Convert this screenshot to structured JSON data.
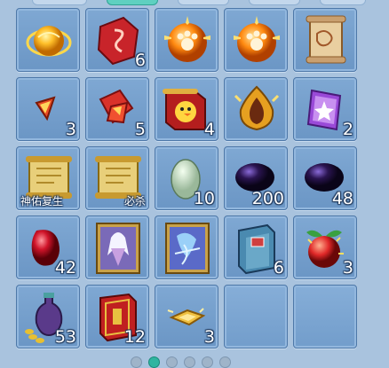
{
  "inventory": {
    "slots": [
      {
        "icon": "golden-orb-icon",
        "count": ""
      },
      {
        "icon": "red-rune-stone-icon",
        "count": "6"
      },
      {
        "icon": "orange-paw-orb-icon",
        "count": ""
      },
      {
        "icon": "orange-paw-orb-icon",
        "count": ""
      },
      {
        "icon": "treasure-map-scroll-icon",
        "count": ""
      },
      {
        "icon": "red-ticket-fragment-icon",
        "count": "3"
      },
      {
        "icon": "red-ticket-bundle-icon",
        "count": "5"
      },
      {
        "icon": "chick-banner-scroll-icon",
        "count": "4"
      },
      {
        "icon": "golden-flame-crystal-icon",
        "count": ""
      },
      {
        "icon": "purple-star-card-icon",
        "count": "2"
      },
      {
        "icon": "golden-scroll-icon",
        "count": "",
        "tag": "神佑复生"
      },
      {
        "icon": "golden-scroll-icon",
        "count": "",
        "tag": "必杀"
      },
      {
        "icon": "pale-green-egg-icon",
        "count": "10"
      },
      {
        "icon": "dark-purple-gem-icon",
        "count": "200"
      },
      {
        "icon": "dark-purple-gem-icon",
        "count": "48"
      },
      {
        "icon": "red-gem-icon",
        "count": "42"
      },
      {
        "icon": "character-card-white-hair-icon",
        "count": ""
      },
      {
        "icon": "character-card-dragon-icon",
        "count": ""
      },
      {
        "icon": "blue-book-icon",
        "count": "6"
      },
      {
        "icon": "magic-fruit-icon",
        "count": "3"
      },
      {
        "icon": "gold-coin-vase-icon",
        "count": "53"
      },
      {
        "icon": "red-gold-book-icon",
        "count": "12"
      },
      {
        "icon": "gold-shard-icon",
        "count": "3"
      },
      {
        "icon": "empty-slot",
        "count": ""
      },
      {
        "icon": "empty-slot",
        "count": ""
      }
    ]
  },
  "pager": {
    "pages": 6,
    "active_index": 1
  },
  "colors": {
    "panel_bg": "#a9c3de",
    "slot_bg": "#7fa8d3",
    "slot_border": "#4e78a8",
    "pager_active": "#2fb5a0"
  }
}
